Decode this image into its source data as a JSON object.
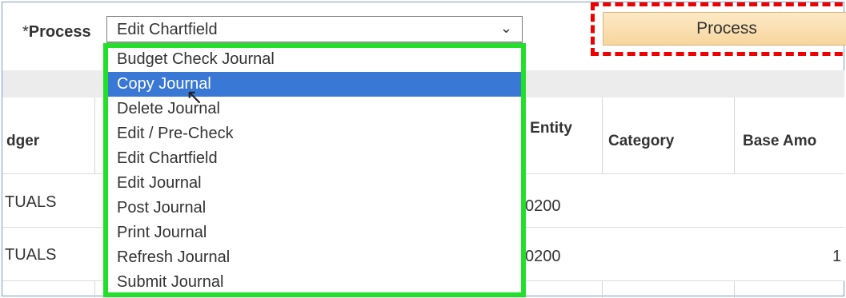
{
  "process": {
    "required_marker": "*",
    "label": "Process",
    "selected_value": "Edit Chartfield",
    "button_label": "Process"
  },
  "table": {
    "headers": [
      "dger",
      "et Entity",
      "Category",
      "Base Amo"
    ],
    "rows": [
      {
        "ledger": "TUALS",
        "entity": "0200",
        "category": "",
        "amount": ""
      },
      {
        "ledger": "TUALS",
        "entity": "0200",
        "category": "",
        "amount": "1"
      }
    ]
  },
  "dropdown": {
    "options": [
      "Budget Check Journal",
      "Copy Journal",
      "Delete Journal",
      "Edit / Pre-Check",
      "Edit Chartfield",
      "Edit Journal",
      "Post Journal",
      "Print Journal",
      "Refresh Journal",
      "Submit Journal"
    ],
    "highlighted_index": 1
  },
  "colors": {
    "highlight": "#3a78d6",
    "annotation_green": "#22e02a",
    "annotation_red": "#ee0000"
  }
}
